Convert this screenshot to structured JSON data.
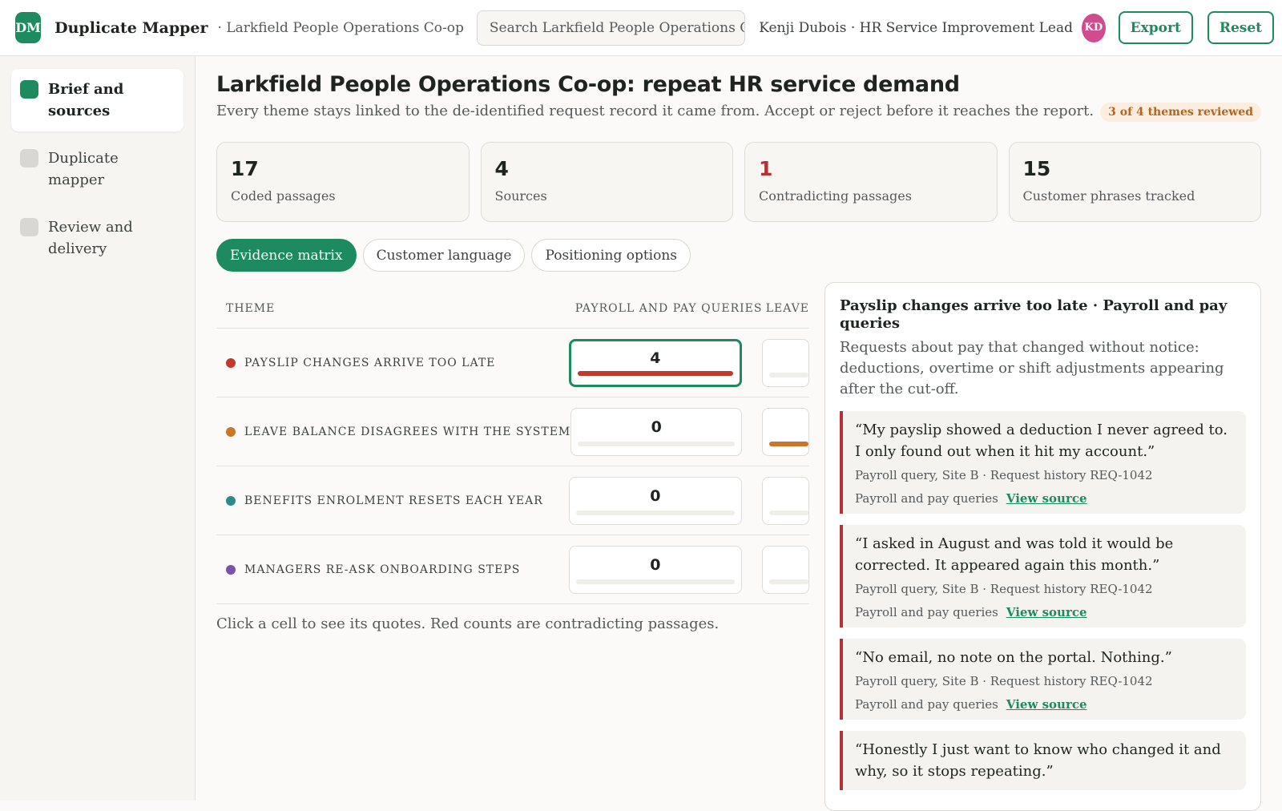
{
  "app": {
    "logo": "DM",
    "name": "Duplicate Mapper",
    "crumb": "· Larkfield People Operations Co-op",
    "search_placeholder": "Search Larkfield People Operations Co-op...",
    "user": "Kenji Dubois · HR Service Improvement Lead",
    "avatar": "KD",
    "export_label": "Export",
    "reset_label": "Reset"
  },
  "sidebar": {
    "items": [
      {
        "label": "Brief and sources"
      },
      {
        "label": "Duplicate mapper"
      },
      {
        "label": "Review and delivery"
      }
    ]
  },
  "page": {
    "title": "Larkfield People Operations Co-op: repeat HR service demand",
    "subtitle": "Every theme stays linked to the de-identified request record it came from. Accept or reject before it reaches the report.",
    "badge": "3 of 4 themes reviewed"
  },
  "stats": [
    {
      "value": "17",
      "label": "Coded passages"
    },
    {
      "value": "4",
      "label": "Sources"
    },
    {
      "value": "1",
      "label": "Contradicting passages"
    },
    {
      "value": "15",
      "label": "Customer phrases tracked"
    }
  ],
  "tabs": [
    {
      "label": "Evidence matrix"
    },
    {
      "label": "Customer language"
    },
    {
      "label": "Positioning options"
    }
  ],
  "matrix": {
    "headers": {
      "theme": "THEME",
      "col_a": "PAYROLL AND PAY QUERIES",
      "col_b": "LEAVE"
    },
    "rows": [
      {
        "theme": "PAYSLIP CHANGES ARRIVE TOO LATE",
        "color": "#c0392b",
        "count": "4",
        "fill_a": 1.0,
        "fill_b": 0.0
      },
      {
        "theme": "LEAVE BALANCE DISAGREES WITH THE SYSTEM",
        "color": "#c9762a",
        "count": "0",
        "fill_a": 0.0,
        "fill_b": 1.0
      },
      {
        "theme": "BENEFITS ENROLMENT RESETS EACH YEAR",
        "color": "#2e8a8a",
        "count": "0",
        "fill_a": 0.0,
        "fill_b": 0.0
      },
      {
        "theme": "MANAGERS RE-ASK ONBOARDING STEPS",
        "color": "#7a52a8",
        "count": "0",
        "fill_a": 0.0,
        "fill_b": 0.0
      }
    ],
    "hint": "Click a cell to see its quotes. Red counts are contradicting passages."
  },
  "panel": {
    "title": "Payslip changes arrive too late · Payroll and pay queries",
    "description": "Requests about pay that changed without notice: deductions, overtime or shift adjustments appearing after the cut-off.",
    "quotes": [
      {
        "text": "“My payslip showed a deduction I never agreed to. I only found out when it hit my account.”",
        "meta": "Payroll query, Site B · Request history REQ-1042",
        "tag": "Payroll and pay queries",
        "link": "View source"
      },
      {
        "text": "“I asked in August and was told it would be corrected. It appeared again this month.”",
        "meta": "Payroll query, Site B · Request history REQ-1042",
        "tag": "Payroll and pay queries",
        "link": "View source"
      },
      {
        "text": "“No email, no note on the portal. Nothing.”",
        "meta": "Payroll query, Site B · Request history REQ-1042",
        "tag": "Payroll and pay queries",
        "link": "View source"
      },
      {
        "text": "“Honestly I just want to know who changed it and why, so it stops repeating.”",
        "meta": "",
        "tag": "",
        "link": ""
      }
    ]
  },
  "colors": {
    "accent": "#1e8a5f",
    "contradict": "#b3323a",
    "badge_text": "#b5651d",
    "avatar": "#d14b8f"
  }
}
